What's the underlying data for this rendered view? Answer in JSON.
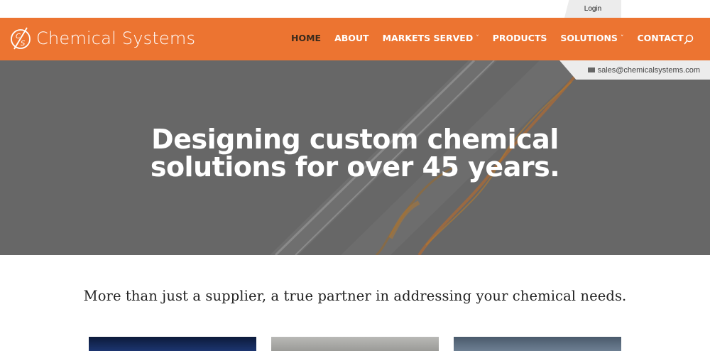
{
  "topbar": {
    "login_label": "Login"
  },
  "header": {
    "logo_text": "Chemical Systems",
    "logo_mark_letters": "CS",
    "nav": [
      {
        "label": "HOME",
        "active": true,
        "dropdown": false
      },
      {
        "label": "ABOUT",
        "active": false,
        "dropdown": false
      },
      {
        "label": "MARKETS SERVED",
        "active": false,
        "dropdown": true
      },
      {
        "label": "PRODUCTS",
        "active": false,
        "dropdown": false
      },
      {
        "label": "SOLUTIONS",
        "active": false,
        "dropdown": true
      },
      {
        "label": "CONTACT",
        "active": false,
        "dropdown": false
      }
    ],
    "chevron_glyph": "˅",
    "search_icon": "search-icon"
  },
  "contact": {
    "email": "sales@chemicalsystems.com",
    "icon": "envelope-icon"
  },
  "hero": {
    "title_line1": "Designing custom chemical",
    "title_line2": "solutions for over 45 years.",
    "slide_count": 5,
    "active_slide": 0
  },
  "intro": {
    "tagline": "More than just a supplier, a true partner in addressing your chemical needs."
  },
  "colors": {
    "brand_orange": "#ec7431",
    "hero_overlay": "#666666",
    "active_nav": "#3a2a1c"
  }
}
